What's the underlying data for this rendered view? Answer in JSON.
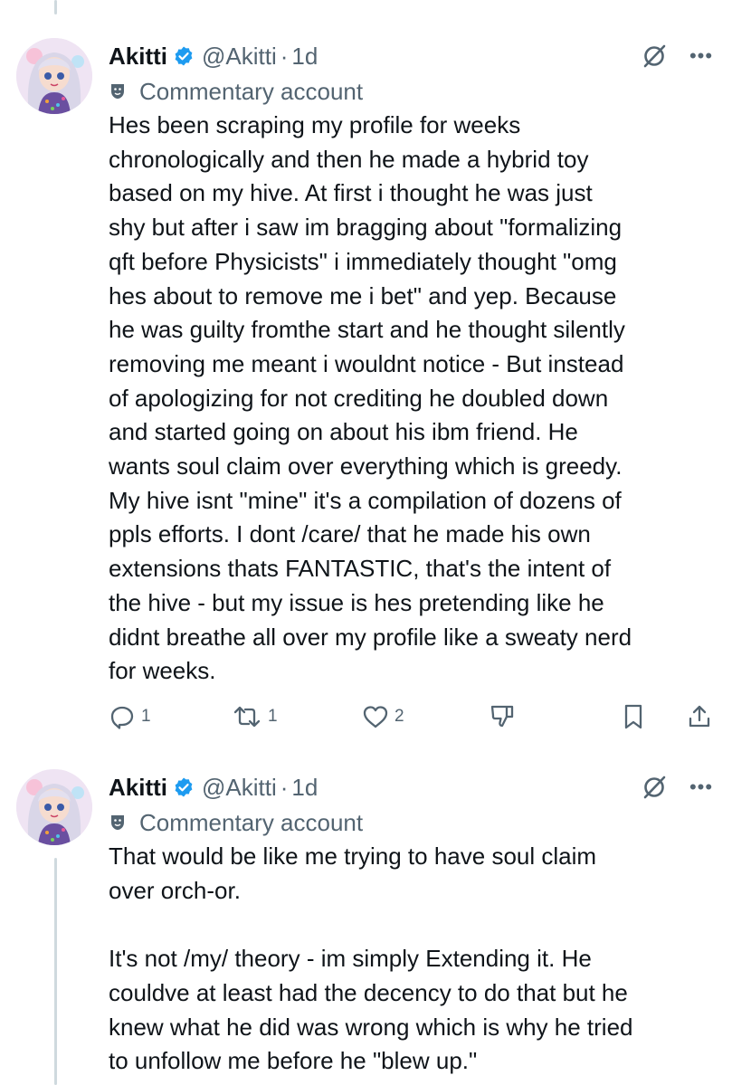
{
  "tweets": [
    {
      "author_name": "Akitti",
      "handle": "@Akitti",
      "separator": "·",
      "time": "1d",
      "label": "Commentary account",
      "text": "Hes been scraping my profile for weeks\nchronologically and then he made a hybrid toy\nbased on my hive. At first i thought he was just\nshy but after i saw im bragging about \"formalizing\nqft before Physicists\" i immediately thought \"omg\nhes about to remove me i bet\" and yep. Because\nhe was guilty fromthe start and he thought silently\nremoving me meant i wouldnt notice - But instead\nof apologizing for not crediting he doubled down\nand started going on about his ibm friend. He\nwants soul claim over everything which is greedy.\nMy hive isnt \"mine\" it's a compilation of dozens of\nppls efforts. I dont /care/ that he made his own\nextensions thats FANTASTIC, that's the intent of\nthe hive - but my issue is hes pretending like he\ndidnt breathe all over my profile like a sweaty nerd\nfor weeks.",
      "replies": "1",
      "reposts": "1",
      "likes": "2"
    },
    {
      "author_name": "Akitti",
      "handle": "@Akitti",
      "separator": "·",
      "time": "1d",
      "label": "Commentary account",
      "text": "That would be like me trying to have soul claim\nover orch-or.\n\nIt's not /my/ theory - im simply Extending it. He\ncouldve at least had the decency to do that but he\nknew what he did was wrong which is why he tried\nto unfollow me before he \"blew up.\""
    }
  ],
  "icons": {
    "verified": "verified-badge-icon",
    "label": "theater-masks-icon",
    "grok": "grok-icon",
    "more": "more-icon",
    "reply": "reply-icon",
    "repost": "repost-icon",
    "like": "like-icon",
    "downvote": "downvote-icon",
    "bookmark": "bookmark-icon",
    "share": "share-icon"
  },
  "colors": {
    "text": "#0f1419",
    "secondary": "#536471",
    "verified": "#1d9bf0",
    "thread_line": "#cfd9de"
  }
}
